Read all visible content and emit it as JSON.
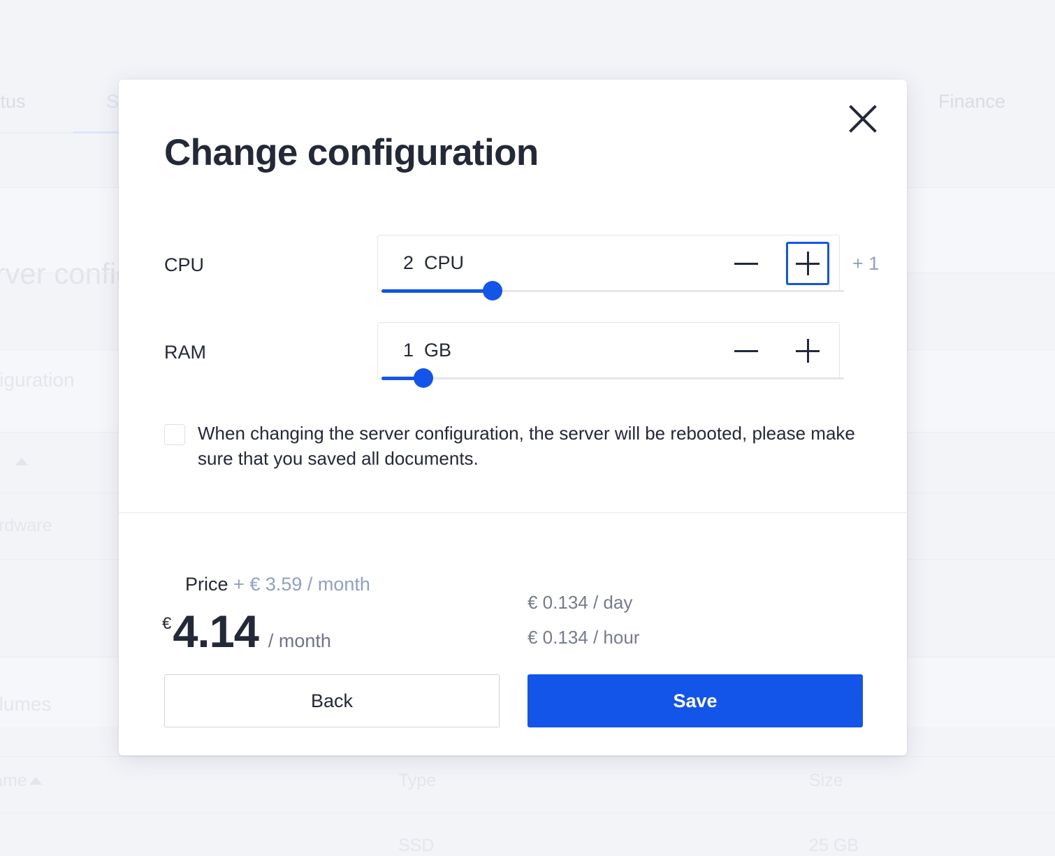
{
  "background": {
    "tabs": [
      {
        "label": "Status",
        "active": false
      },
      {
        "label": "Settings",
        "active": true
      },
      {
        "label": "Finance",
        "active": false
      }
    ],
    "heading": "Server configuration",
    "subheading": "Configuration",
    "text_fragment": "Hardware",
    "volumes_heading": "Volumes",
    "table": {
      "columns": [
        "Name",
        "Type",
        "Size"
      ],
      "sort_column": "Name",
      "sort_direction": "asc",
      "rows": [
        {
          "name": "",
          "type": "SSD",
          "size": "25 GB"
        }
      ]
    }
  },
  "modal": {
    "title": "Change configuration",
    "close_label": "close-icon",
    "rows": [
      {
        "key": "cpu",
        "label": "CPU",
        "value": "2  CPU",
        "minus_label": "minus-icon",
        "plus_label": "plus-icon",
        "delta_badge": "+ 1",
        "plus_focused": true,
        "slider_percent": 24
      },
      {
        "key": "ram",
        "label": "RAM",
        "value": "1  GB",
        "minus_label": "minus-icon",
        "plus_label": "plus-icon",
        "delta_badge": "",
        "plus_focused": false,
        "slider_percent": 9
      }
    ],
    "note": {
      "checked": false,
      "text": "When changing the server configuration, the server will be rebooted, please make sure that you saved all documents."
    },
    "price": {
      "label": "Price",
      "delta": "+ € 3.59 / month",
      "currency": "€",
      "amount": "4.14",
      "period": "/ month",
      "rate_day": "€ 0.134 / day",
      "rate_hour": "€ 0.134 / hour"
    },
    "actions": {
      "back_label": "Back",
      "save_label": "Save"
    }
  },
  "colors": {
    "accent": "#1355e9",
    "text": "#242938",
    "muted_blue": "#8fa0c6",
    "page_bg": "#f3f4f8"
  }
}
